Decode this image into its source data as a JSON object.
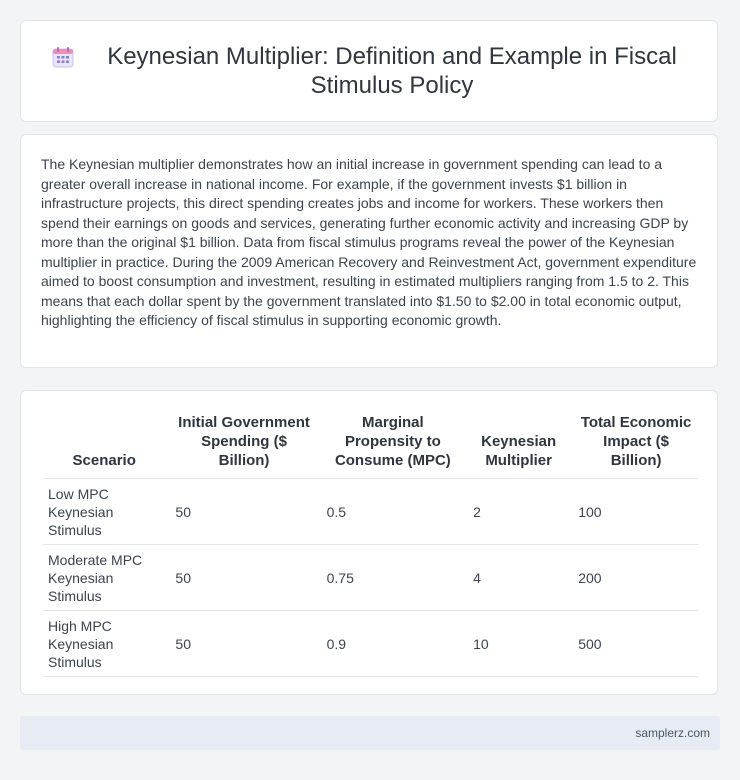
{
  "header": {
    "icon": "calendar-icon",
    "title": "Keynesian Multiplier: Definition and Example in Fiscal Stimulus Policy"
  },
  "intro": {
    "text": "The Keynesian multiplier demonstrates how an initial increase in government spending can lead to a greater overall increase in national income. For example, if the government invests $1 billion in infrastructure projects, this direct spending creates jobs and income for workers. These workers then spend their earnings on goods and services, generating further economic activity and increasing GDP by more than the original $1 billion. Data from fiscal stimulus programs reveal the power of the Keynesian multiplier in practice. During the 2009 American Recovery and Reinvestment Act, government expenditure aimed to boost consumption and investment, resulting in estimated multipliers ranging from 1.5 to 2. This means that each dollar spent by the government translated into $1.50 to $2.00 in total economic output, highlighting the efficiency of fiscal stimulus in supporting economic growth."
  },
  "table": {
    "headers": [
      "Scenario",
      "Initial Government Spending ($ Billion)",
      "Marginal Propensity to Consume (MPC)",
      "Keynesian Multiplier",
      "Total Economic Impact ($ Billion)"
    ],
    "rows": [
      [
        "Low MPC Keynesian Stimulus",
        "50",
        "0.5",
        "2",
        "100"
      ],
      [
        "Moderate MPC Keynesian Stimulus",
        "50",
        "0.75",
        "4",
        "200"
      ],
      [
        "High MPC Keynesian Stimulus",
        "50",
        "0.9",
        "10",
        "500"
      ]
    ]
  },
  "footer": {
    "site": "samplerz.com"
  },
  "colors": {
    "background": "#f3f4f6",
    "card": "#ffffff",
    "footer_bg": "#e6ebf4",
    "icon_accent": "#8b7bd8"
  }
}
